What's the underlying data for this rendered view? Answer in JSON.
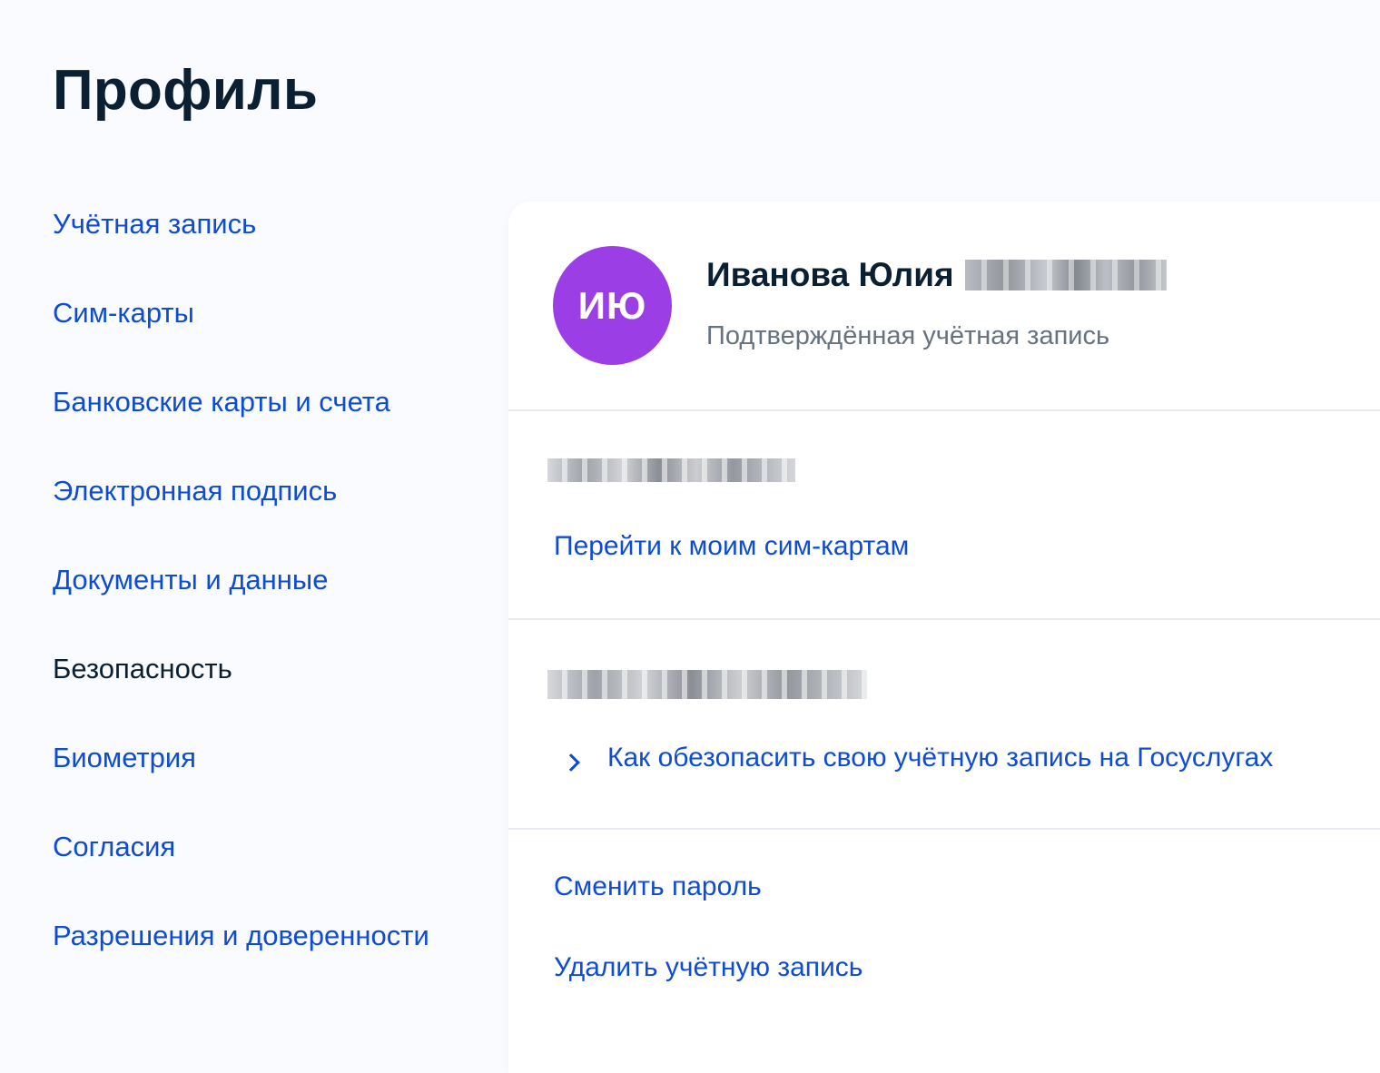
{
  "page": {
    "title": "Профиль"
  },
  "sidebar": {
    "items": [
      {
        "label": "Учётная запись",
        "active": false
      },
      {
        "label": "Сим-карты",
        "active": false
      },
      {
        "label": "Банковские карты и счета",
        "active": false
      },
      {
        "label": "Электронная подпись",
        "active": false
      },
      {
        "label": "Документы и данные",
        "active": false
      },
      {
        "label": "Безопасность",
        "active": true
      },
      {
        "label": "Биометрия",
        "active": false
      },
      {
        "label": "Согласия",
        "active": false
      },
      {
        "label": "Разрешения и доверенности",
        "active": false
      }
    ]
  },
  "profile": {
    "initials": "ИЮ",
    "name": "Иванова Юлия",
    "status": "Подтверждённая учётная запись",
    "avatar_color": "#9b3ee5"
  },
  "phone_section": {
    "link": "Перейти к моим сим-картам"
  },
  "email_section": {
    "link": "Как обезопасить свою учётную запись на Госуслугах",
    "link_icon": "chevron-right-icon"
  },
  "actions": {
    "change_password": "Сменить пароль",
    "delete_account": "Удалить учётную запись"
  },
  "colors": {
    "link": "#0d4cd3",
    "text": "#0b1f33",
    "muted": "#66727f",
    "background": "#f9fbfe",
    "divider": "#e6ebf2"
  }
}
